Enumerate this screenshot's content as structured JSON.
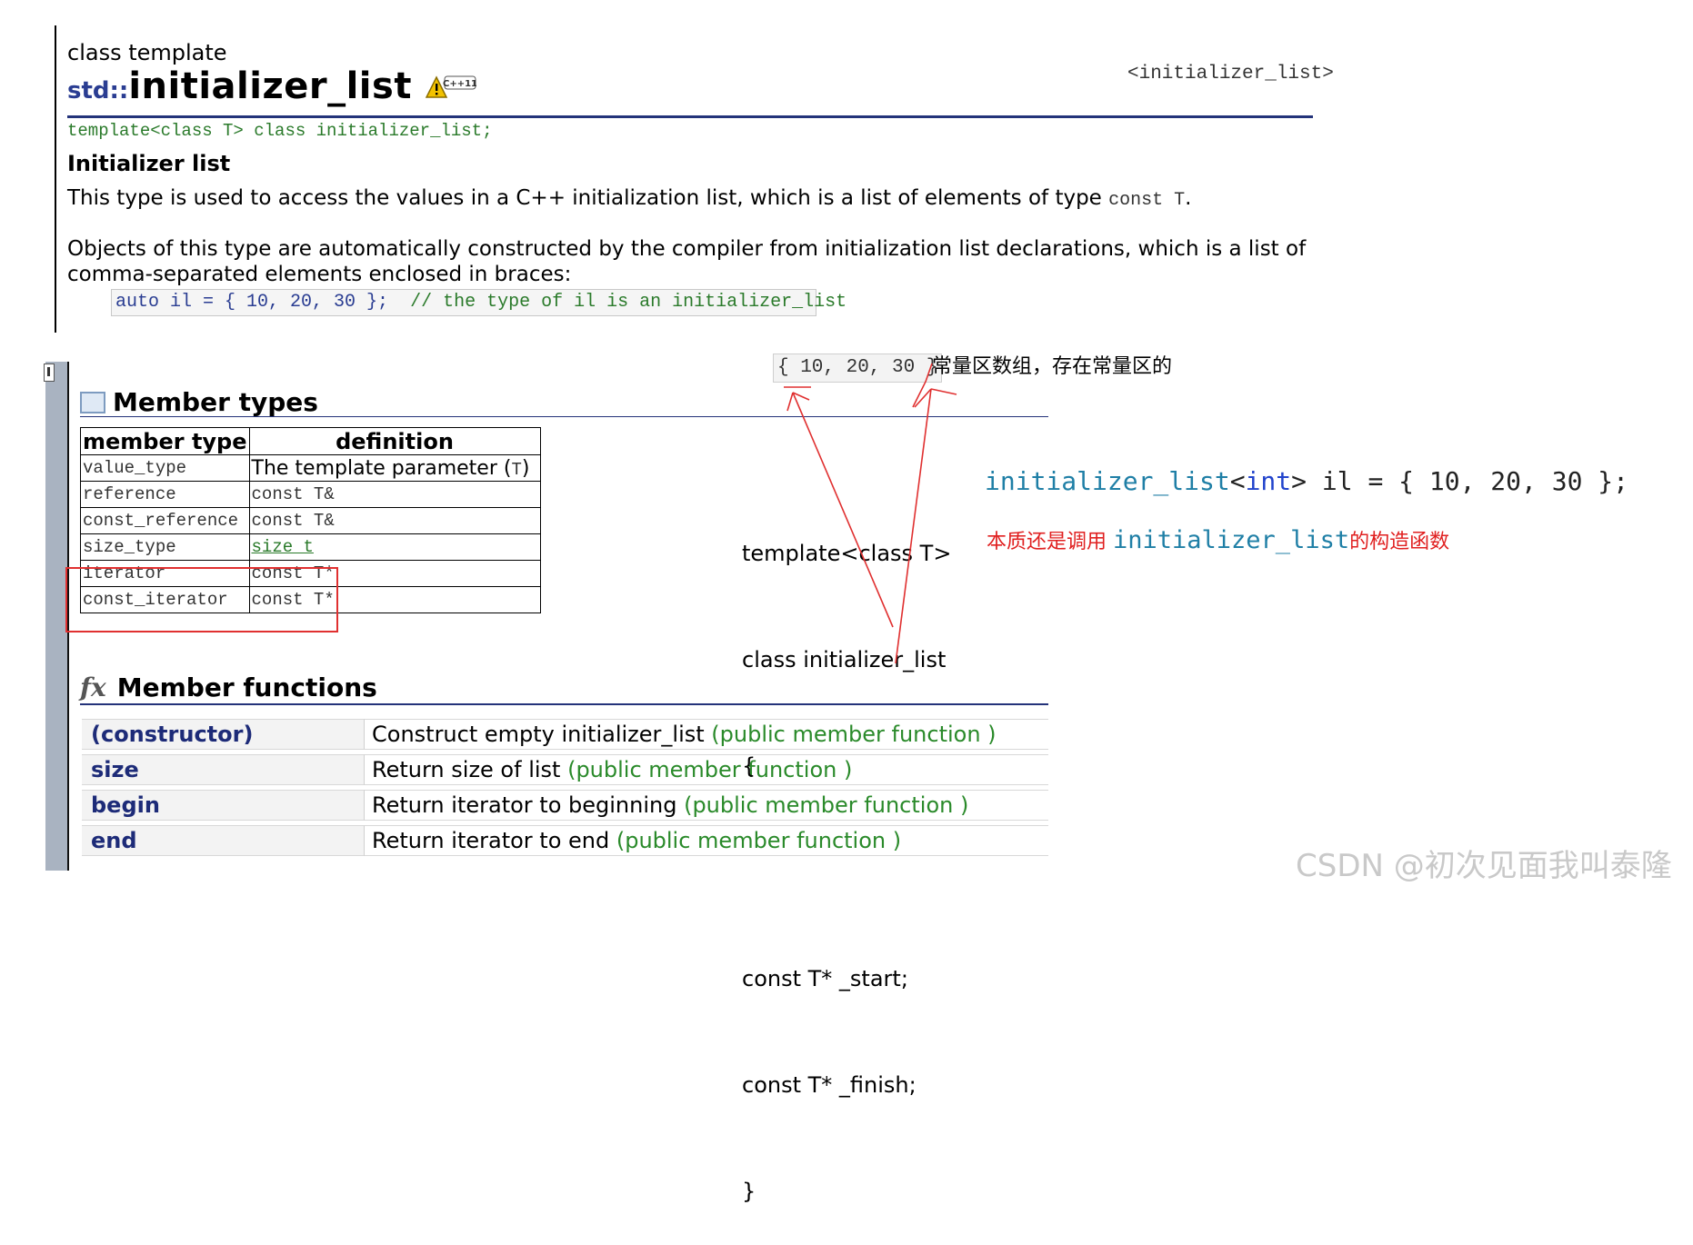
{
  "header": {
    "kind": "class template",
    "namespace": "std::",
    "name": "initializer_list",
    "badge": "C++11",
    "header_tag": "<initializer_list>",
    "template_decl": "template<class T> class initializer_list;"
  },
  "intro": {
    "heading": "Initializer list",
    "p1_text": "This type is used to access the values in a C++ initialization list, which is a list of elements of type ",
    "p1_code": "const T",
    "p1_end": ".",
    "p2": "Objects of this type are automatically constructed by the compiler from initialization list declarations, which is a list of comma-separated elements enclosed in braces:",
    "code": "auto il = { 10, 20, 30 };",
    "code_comment": "// the type of il is an initializer_list"
  },
  "member_types": {
    "title": "Member types",
    "headers": [
      "member type",
      "definition"
    ],
    "rows": [
      {
        "type": "value_type",
        "def": "The template parameter (",
        "def_param": "T",
        "def_end": ")"
      },
      {
        "type": "reference",
        "def": "const T&"
      },
      {
        "type": "const_reference",
        "def": "const T&"
      },
      {
        "type": "size_type",
        "def": "size_t"
      },
      {
        "type": "iterator",
        "def": "const T*"
      },
      {
        "type": "const_iterator",
        "def": "const T*"
      }
    ]
  },
  "member_functions": {
    "title": "Member functions",
    "icon": "fx",
    "rows": [
      {
        "name": "(constructor)",
        "desc": "Construct empty initializer_list ",
        "kind": "(public member function )"
      },
      {
        "name": "size",
        "desc": "Return size of list ",
        "kind": "(public member function )"
      },
      {
        "name": "begin",
        "desc": "Return iterator to beginning ",
        "kind": "(public member function )"
      },
      {
        "name": "end",
        "desc": "Return iterator to end ",
        "kind": "(public member function )"
      }
    ]
  },
  "annotations": {
    "array_literal": "{ 10, 20, 30 }",
    "array_note": "常量区数组，存在常量区的",
    "struct_lines": [
      "template<class T>",
      "class initializer_list",
      "{",
      "",
      "const T* _start;",
      "const T* _finish;",
      "}"
    ],
    "il_code": {
      "cls": "initializer_list",
      "lt": "<",
      "kw": "int",
      "rest": "> il = { 10, 20, 30 };"
    },
    "il_note_prefix": "本质还是调用 ",
    "il_note_cls": "initializer_list",
    "il_note_suffix": "的构造函数",
    "arrow_color": "#e03030"
  },
  "watermark": "CSDN @初次见面我叫泰隆"
}
